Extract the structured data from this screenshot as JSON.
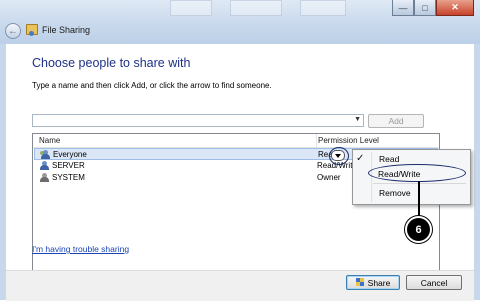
{
  "window": {
    "title": "File Sharing"
  },
  "dialog": {
    "heading": "Choose people to share with",
    "instruction": "Type a name and then click Add, or click the arrow to find someone.",
    "name_input_value": "",
    "add_button": "Add"
  },
  "grid": {
    "headers": {
      "name": "Name",
      "permission": "Permission Level"
    },
    "rows": [
      {
        "name": "Everyone",
        "permission": "Read",
        "icon": "group-user-icon",
        "selected": true
      },
      {
        "name": "SERVER",
        "permission": "Read/Write",
        "icon": "user-icon",
        "selected": false
      },
      {
        "name": "SYSTEM",
        "permission": "Owner",
        "icon": "system-user-icon",
        "selected": false
      }
    ]
  },
  "permission_menu": {
    "items": [
      {
        "label": "Read",
        "checked": true
      },
      {
        "label": "Read/Write",
        "checked": false,
        "highlighted": true
      },
      {
        "label": "Remove",
        "checked": false
      }
    ]
  },
  "callout": {
    "label": "6"
  },
  "links": {
    "trouble": "I'm having trouble sharing"
  },
  "footer": {
    "share_button": "Share",
    "cancel_button": "Cancel"
  },
  "colors": {
    "heading": "#1e3287",
    "link": "#1a44b8",
    "callout": "#000000"
  }
}
